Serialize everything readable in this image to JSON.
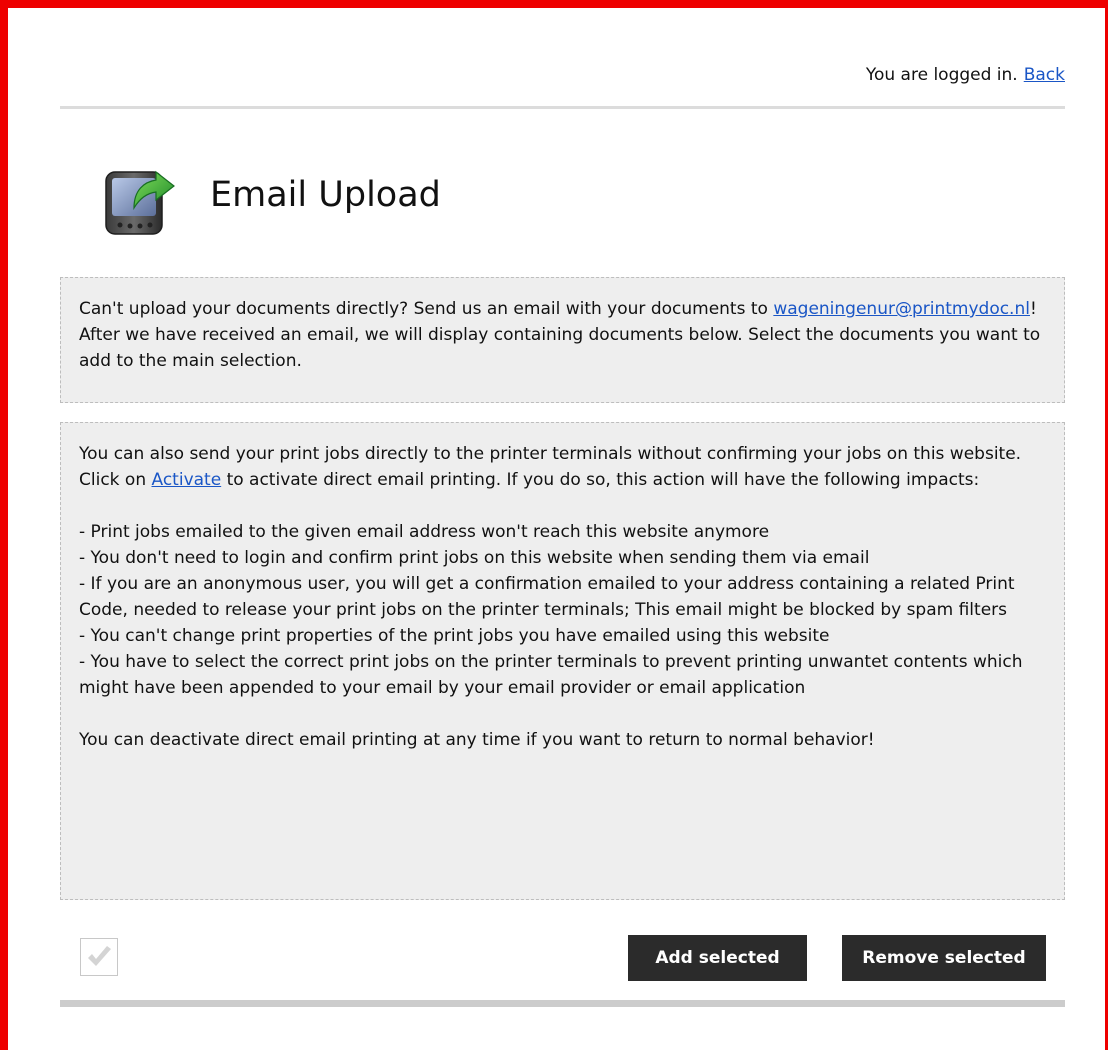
{
  "topbar": {
    "status_text": "You are logged in.",
    "back_label": "Back"
  },
  "header": {
    "icon": "pda-upload-icon",
    "title": "Email Upload"
  },
  "info_box": {
    "text_before_email": "Can't upload your documents directly? Send us an email with your documents to ",
    "email_link": "wageningenur@printmydoc.nl",
    "text_after_email": "! After we have received an email, we will display containing documents below. Select the documents you want to add to the main selection."
  },
  "direct_box": {
    "intro_before_link": "You can also send your print jobs directly to the printer terminals without confirming your jobs on this website. Click on ",
    "activate_link": "Activate",
    "intro_after_link": " to activate direct email printing. If you do so, this action will have the following impacts:",
    "impacts": [
      "- Print jobs emailed to the given email address won't reach this website anymore",
      "- You don't need to login and confirm print jobs on this website when sending them via email",
      "- If you are an anonymous user, you will get a confirmation emailed to your address containing a related Print Code, needed to release your print jobs on the printer terminals; This email might be blocked by spam filters",
      "- You can't change print properties of the print jobs you have emailed using this website",
      "- You have to select the correct print jobs on the printer terminals to prevent printing unwantet contents which might have been appended to your email by your email provider or email application"
    ],
    "footer_text": "You can deactivate direct email printing at any time if you want to return to normal behavior!"
  },
  "actions": {
    "select_all_icon": "check-icon",
    "add_label": "Add selected",
    "remove_label": "Remove selected"
  },
  "colors": {
    "frame": "#ee0000",
    "link": "#1a56c6",
    "button_bg": "#2b2b2b",
    "box_bg": "#eeeeee",
    "arrow": "#3aa83a"
  }
}
